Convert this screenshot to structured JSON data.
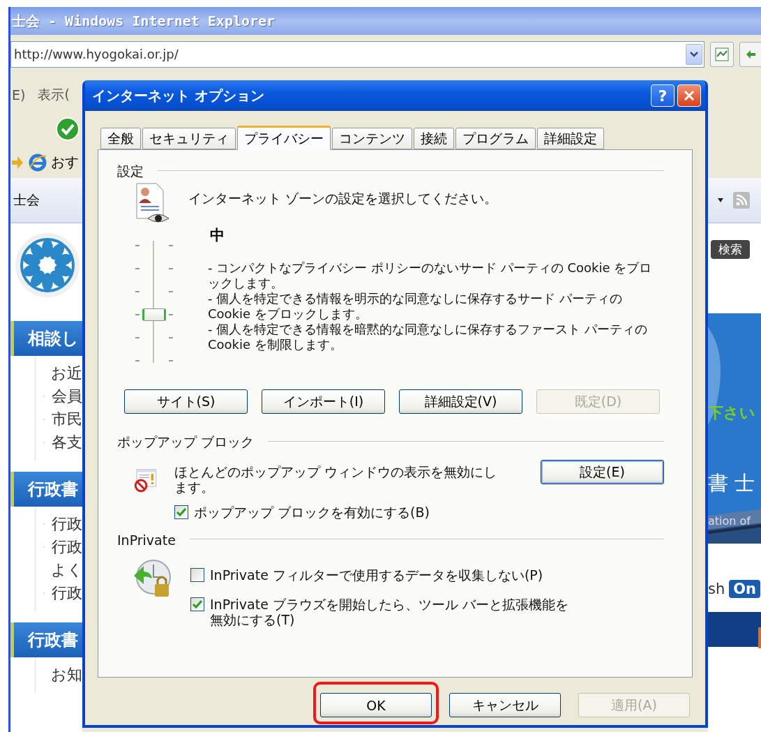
{
  "browser": {
    "title": "士会 - Windows Internet Explorer",
    "address": "http://www.hyogokai.or.jp/",
    "menu": [
      "E)",
      "表示("
    ],
    "favorites": "おす",
    "tab": "士会"
  },
  "page": {
    "sidebar": [
      {
        "heading": "相談し",
        "items": [
          "お近",
          "会員",
          "市民",
          "各支"
        ]
      },
      {
        "heading": "行政書",
        "items": [
          "行政",
          "行政",
          "よく",
          "行政"
        ]
      },
      {
        "heading": "行政書",
        "items": [
          "お知"
        ]
      }
    ],
    "search_button": "検索",
    "banner": {
      "tagline": "下さい",
      "title": "書 士",
      "subtitle": "ation of"
    },
    "language": {
      "label": "sh",
      "badge": "On"
    }
  },
  "dialog": {
    "title": "インターネット オプション",
    "help": "?",
    "tabs": [
      {
        "label": "全般",
        "selected": false
      },
      {
        "label": "セキュリティ",
        "selected": false
      },
      {
        "label": "プライバシー",
        "selected": true
      },
      {
        "label": "コンテンツ",
        "selected": false
      },
      {
        "label": "接続",
        "selected": false
      },
      {
        "label": "プログラム",
        "selected": false
      },
      {
        "label": "詳細設定",
        "selected": false
      }
    ],
    "privacy": {
      "section": "設定",
      "prompt": "インターネット ゾーンの設定を選択してください。",
      "level_name": "中",
      "slider": {
        "level": 0.4
      },
      "description": [
        "- コンパクトなプライバシー ポリシーのないサード パーティの Cookie をブロックします。",
        "- 個人を特定できる情報を明示的な同意なしに保存するサード パーティの Cookie をブロックします。",
        "- 個人を特定できる情報を暗黙的な同意なしに保存するファースト パーティの Cookie を制限します。"
      ],
      "buttons": [
        {
          "label": "サイト(S)",
          "disabled": false
        },
        {
          "label": "インポート(I)",
          "disabled": false
        },
        {
          "label": "詳細設定(V)",
          "disabled": false
        },
        {
          "label": "既定(D)",
          "disabled": true
        }
      ]
    },
    "popup": {
      "section": "ポップアップ ブロック",
      "text": "ほとんどのポップアップ ウィンドウの表示を無効にします。",
      "settings_button": "設定(E)",
      "checkbox": {
        "label": "ポップアップ ブロックを有効にする(B)",
        "checked": true
      }
    },
    "inprivate": {
      "section": "InPrivate",
      "checkboxes": [
        {
          "label": "InPrivate フィルターで使用するデータを収集しない(P)",
          "checked": false
        },
        {
          "label": "InPrivate ブラウズを開始したら、ツール バーと拡張機能を無効にする(T)",
          "checked": true
        }
      ]
    },
    "footer_buttons": [
      {
        "label": "OK",
        "disabled": false,
        "highlighted": true
      },
      {
        "label": "キャンセル",
        "disabled": false,
        "highlighted": false
      },
      {
        "label": "適用(A)",
        "disabled": true,
        "highlighted": false
      }
    ]
  }
}
